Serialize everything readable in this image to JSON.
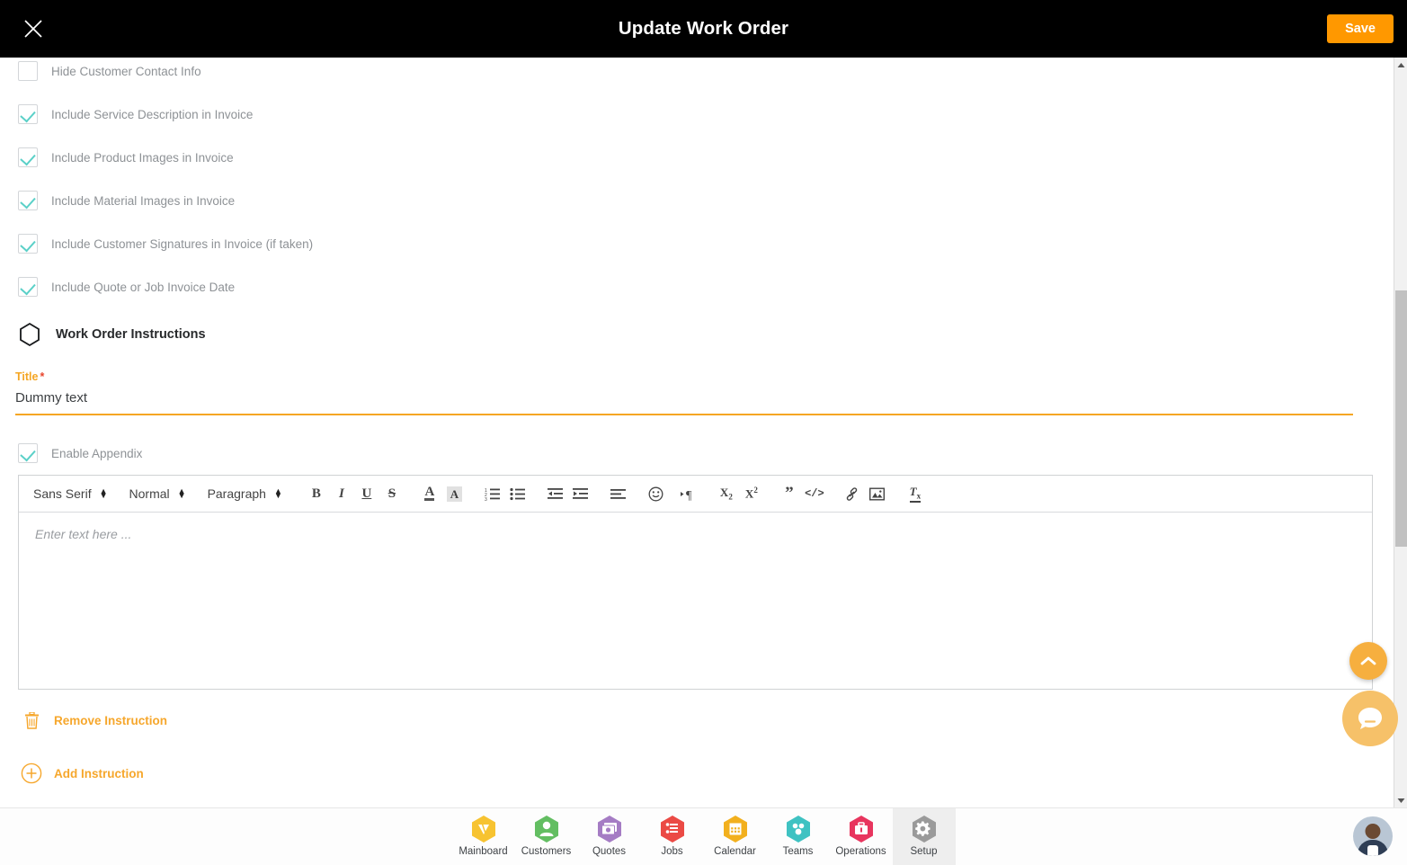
{
  "header": {
    "title": "Update Work Order",
    "close_icon": "close-icon",
    "save_label": "Save",
    "accent_color": "#FF9800"
  },
  "checkboxes": [
    {
      "label": "Hide Customer Contact Info",
      "checked": false
    },
    {
      "label": "Include Service Description in Invoice",
      "checked": true
    },
    {
      "label": "Include Product Images in Invoice",
      "checked": true
    },
    {
      "label": "Include Material Images in Invoice",
      "checked": true
    },
    {
      "label": "Include Customer Signatures in Invoice (if taken)",
      "checked": true
    },
    {
      "label": "Include Quote or Job Invoice Date",
      "checked": true
    }
  ],
  "section": {
    "icon": "hexagon-icon",
    "title": "Work Order Instructions"
  },
  "title_field": {
    "label": "Title",
    "required_mark": "*",
    "value": "Dummy text",
    "label_color": "#F5A623",
    "underline_color": "#F5A623"
  },
  "appendix": {
    "label": "Enable Appendix",
    "checked": true
  },
  "editor": {
    "font_select": "Sans Serif",
    "size_select": "Normal",
    "block_select": "Paragraph",
    "placeholder": "Enter text here ...",
    "tools": [
      {
        "name": "bold-icon",
        "glyph": "B"
      },
      {
        "name": "italic-icon",
        "glyph": "I"
      },
      {
        "name": "underline-icon",
        "glyph": "U"
      },
      {
        "name": "strikethrough-icon",
        "glyph": "S"
      },
      {
        "name": "text-color-icon",
        "glyph": "A"
      },
      {
        "name": "background-color-icon",
        "glyph": "A"
      },
      {
        "name": "ordered-list-icon",
        "glyph": "1."
      },
      {
        "name": "bullet-list-icon",
        "glyph": "•"
      },
      {
        "name": "outdent-icon",
        "glyph": "←"
      },
      {
        "name": "indent-icon",
        "glyph": "→"
      },
      {
        "name": "align-icon",
        "glyph": "≡"
      },
      {
        "name": "emoji-icon",
        "glyph": "☺"
      },
      {
        "name": "text-direction-icon",
        "glyph": "¶"
      },
      {
        "name": "subscript-icon",
        "glyph": "X₂"
      },
      {
        "name": "superscript-icon",
        "glyph": "X²"
      },
      {
        "name": "blockquote-icon",
        "glyph": "”"
      },
      {
        "name": "code-block-icon",
        "glyph": "</>"
      },
      {
        "name": "link-icon",
        "glyph": "🔗"
      },
      {
        "name": "image-icon",
        "glyph": "🖼"
      },
      {
        "name": "clear-format-icon",
        "glyph": "Tx"
      }
    ]
  },
  "actions": {
    "remove_label": "Remove Instruction",
    "remove_icon": "trash-icon",
    "add_label": "Add Instruction",
    "add_icon": "plus-circle-icon",
    "link_color": "#F6A72C"
  },
  "floating": {
    "scroll_top_icon": "chevron-up-icon",
    "chat_icon": "chat-bubble-icon"
  },
  "bottom_nav": {
    "items": [
      {
        "label": "Mainboard",
        "icon": "mainboard-icon",
        "color": "#F7C331",
        "active": false
      },
      {
        "label": "Customers",
        "icon": "customers-icon",
        "color": "#63BE62",
        "active": false
      },
      {
        "label": "Quotes",
        "icon": "quotes-icon",
        "color": "#A57CC4",
        "active": false
      },
      {
        "label": "Jobs",
        "icon": "jobs-icon",
        "color": "#EB4A45",
        "active": false
      },
      {
        "label": "Calendar",
        "icon": "calendar-icon",
        "color": "#F2B01E",
        "active": false
      },
      {
        "label": "Teams",
        "icon": "teams-icon",
        "color": "#3FC2C2",
        "active": false
      },
      {
        "label": "Operations",
        "icon": "operations-icon",
        "color": "#E8355E",
        "active": false
      },
      {
        "label": "Setup",
        "icon": "setup-icon",
        "color": "#9A9A9A",
        "active": true
      }
    ],
    "avatar": "user-avatar"
  }
}
